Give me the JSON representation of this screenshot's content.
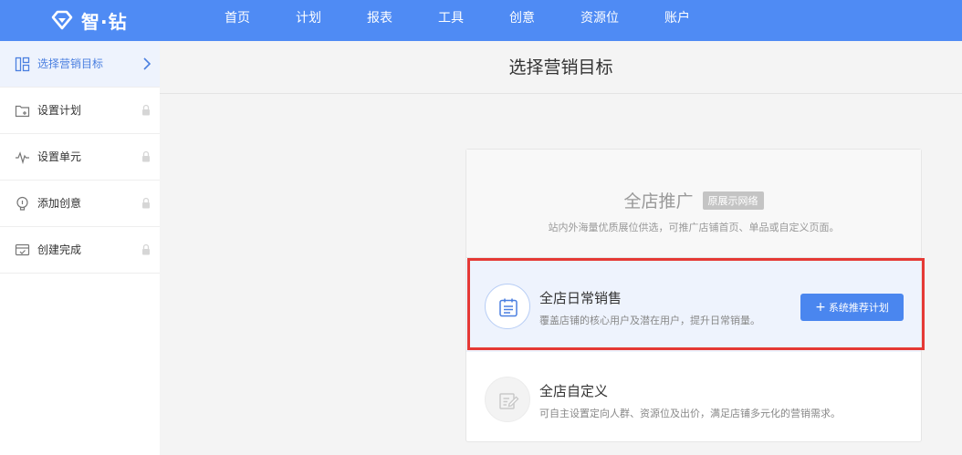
{
  "brand": {
    "name": "智·钻"
  },
  "nav": {
    "items": [
      {
        "label": "首页"
      },
      {
        "label": "计划"
      },
      {
        "label": "报表"
      },
      {
        "label": "工具"
      },
      {
        "label": "创意"
      },
      {
        "label": "资源位"
      },
      {
        "label": "账户"
      }
    ]
  },
  "sidebar": {
    "items": [
      {
        "label": "选择营销目标",
        "icon": "layout-icon",
        "state": "active"
      },
      {
        "label": "设置计划",
        "icon": "folder-add-icon",
        "state": "locked"
      },
      {
        "label": "设置单元",
        "icon": "pulse-icon",
        "state": "locked"
      },
      {
        "label": "添加创意",
        "icon": "lightbulb-icon",
        "state": "locked"
      },
      {
        "label": "创建完成",
        "icon": "card-check-icon",
        "state": "locked"
      }
    ]
  },
  "main": {
    "title": "选择营销目标",
    "panel": {
      "title": "全店推广",
      "tag": "原展示网络",
      "description": "站内外海量优质展位供选，可推广店铺首页、单品或自定义页面。",
      "options": [
        {
          "title": "全店日常销售",
          "description": "覆盖店铺的核心用户及潜在用户，提升日常销量。",
          "icon": "calendar-icon",
          "selected": true,
          "button": "系统推荐计划",
          "button_icon": "+"
        },
        {
          "title": "全店自定义",
          "description": "可自主设置定向人群、资源位及出价，满足店铺多元化的营销需求。",
          "icon": "edit-icon",
          "selected": false
        }
      ]
    }
  },
  "colors": {
    "topbar": "#4f8bf4",
    "accent": "#4a86ef",
    "selected_bg": "#eef3fd",
    "highlight": "#e53935"
  }
}
